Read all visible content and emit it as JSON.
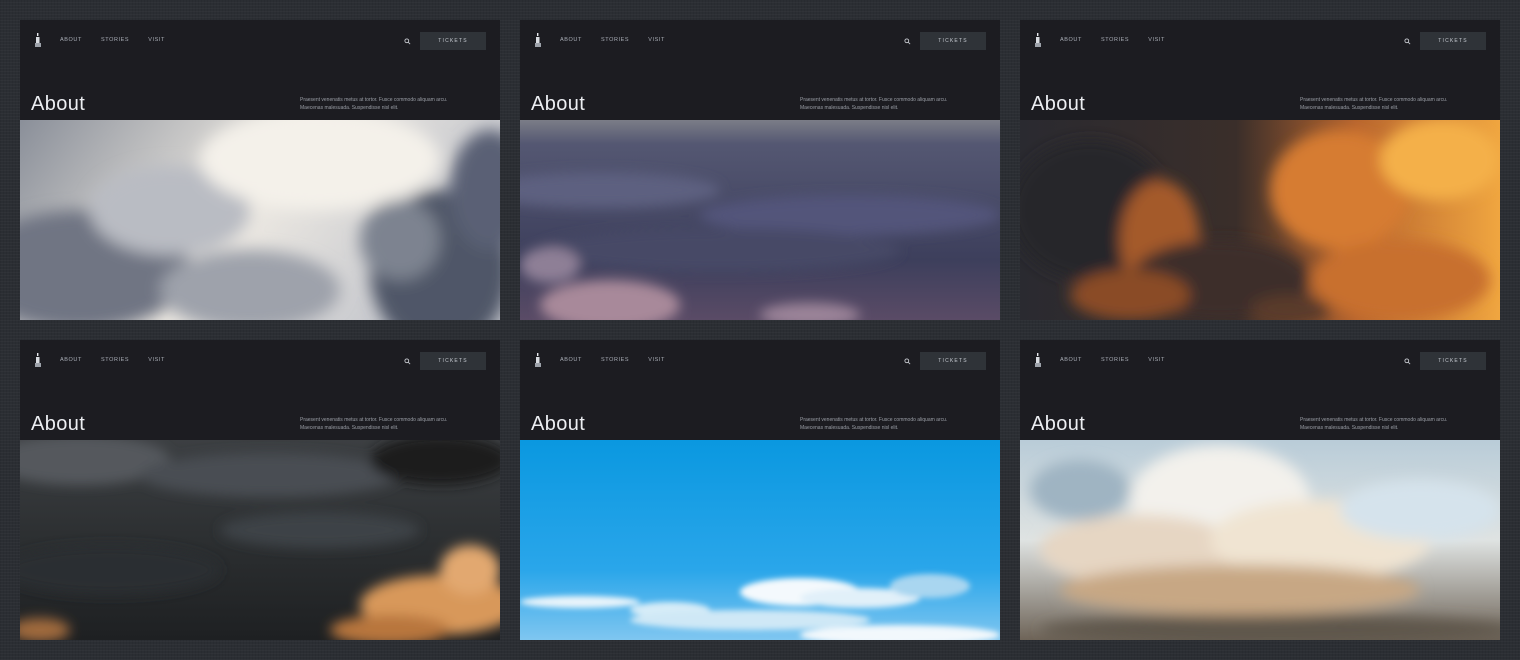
{
  "cards": [
    {
      "nav": [
        "ABOUT",
        "STORIES",
        "VISIT"
      ],
      "tickets_label": "TICKETS",
      "title": "About",
      "intro": "Praesent venenatis metus at tortor. Fusce commodo aliquam arcu. Maecenas malesuada. Suspendisse nisl elit.",
      "hero": "overcast grey clouds"
    },
    {
      "nav": [
        "ABOUT",
        "STORIES",
        "VISIT"
      ],
      "tickets_label": "TICKETS",
      "title": "About",
      "intro": "Praesent venenatis metus at tortor. Fusce commodo aliquam arcu. Maecenas malesuada. Suspendisse nisl elit.",
      "hero": "purple dusk cloud layer"
    },
    {
      "nav": [
        "ABOUT",
        "STORIES",
        "VISIT"
      ],
      "tickets_label": "TICKETS",
      "title": "About",
      "intro": "Praesent venenatis metus at tortor. Fusce commodo aliquam arcu. Maecenas malesuada. Suspendisse nisl elit.",
      "hero": "orange sunset storm clouds"
    },
    {
      "nav": [
        "ABOUT",
        "STORIES",
        "VISIT"
      ],
      "tickets_label": "TICKETS",
      "title": "About",
      "intro": "Praesent venenatis metus at tortor. Fusce commodo aliquam arcu. Maecenas malesuada. Suspendisse nisl elit.",
      "hero": "dark storm sky with glowing cloud"
    },
    {
      "nav": [
        "ABOUT",
        "STORIES",
        "VISIT"
      ],
      "tickets_label": "TICKETS",
      "title": "About",
      "intro": "Praesent venenatis metus at tortor. Fusce commodo aliquam arcu. Maecenas malesuada. Suspendisse nisl elit.",
      "hero": "bright blue sky over cloud tops"
    },
    {
      "nav": [
        "ABOUT",
        "STORIES",
        "VISIT"
      ],
      "tickets_label": "TICKETS",
      "title": "About",
      "intro": "Praesent venenatis metus at tortor. Fusce commodo aliquam arcu. Maecenas malesuada. Suspendisse nisl elit.",
      "hero": "pale pastel cumulus"
    }
  ],
  "colors": {
    "page_background": "#2b2e33",
    "card_background": "#1c1c21",
    "button_background": "#2f3338",
    "title_text": "#eceef2",
    "nav_text": "#a9adb6"
  },
  "icons": {
    "logo": "lighthouse-logo-icon",
    "search": "search-icon"
  }
}
